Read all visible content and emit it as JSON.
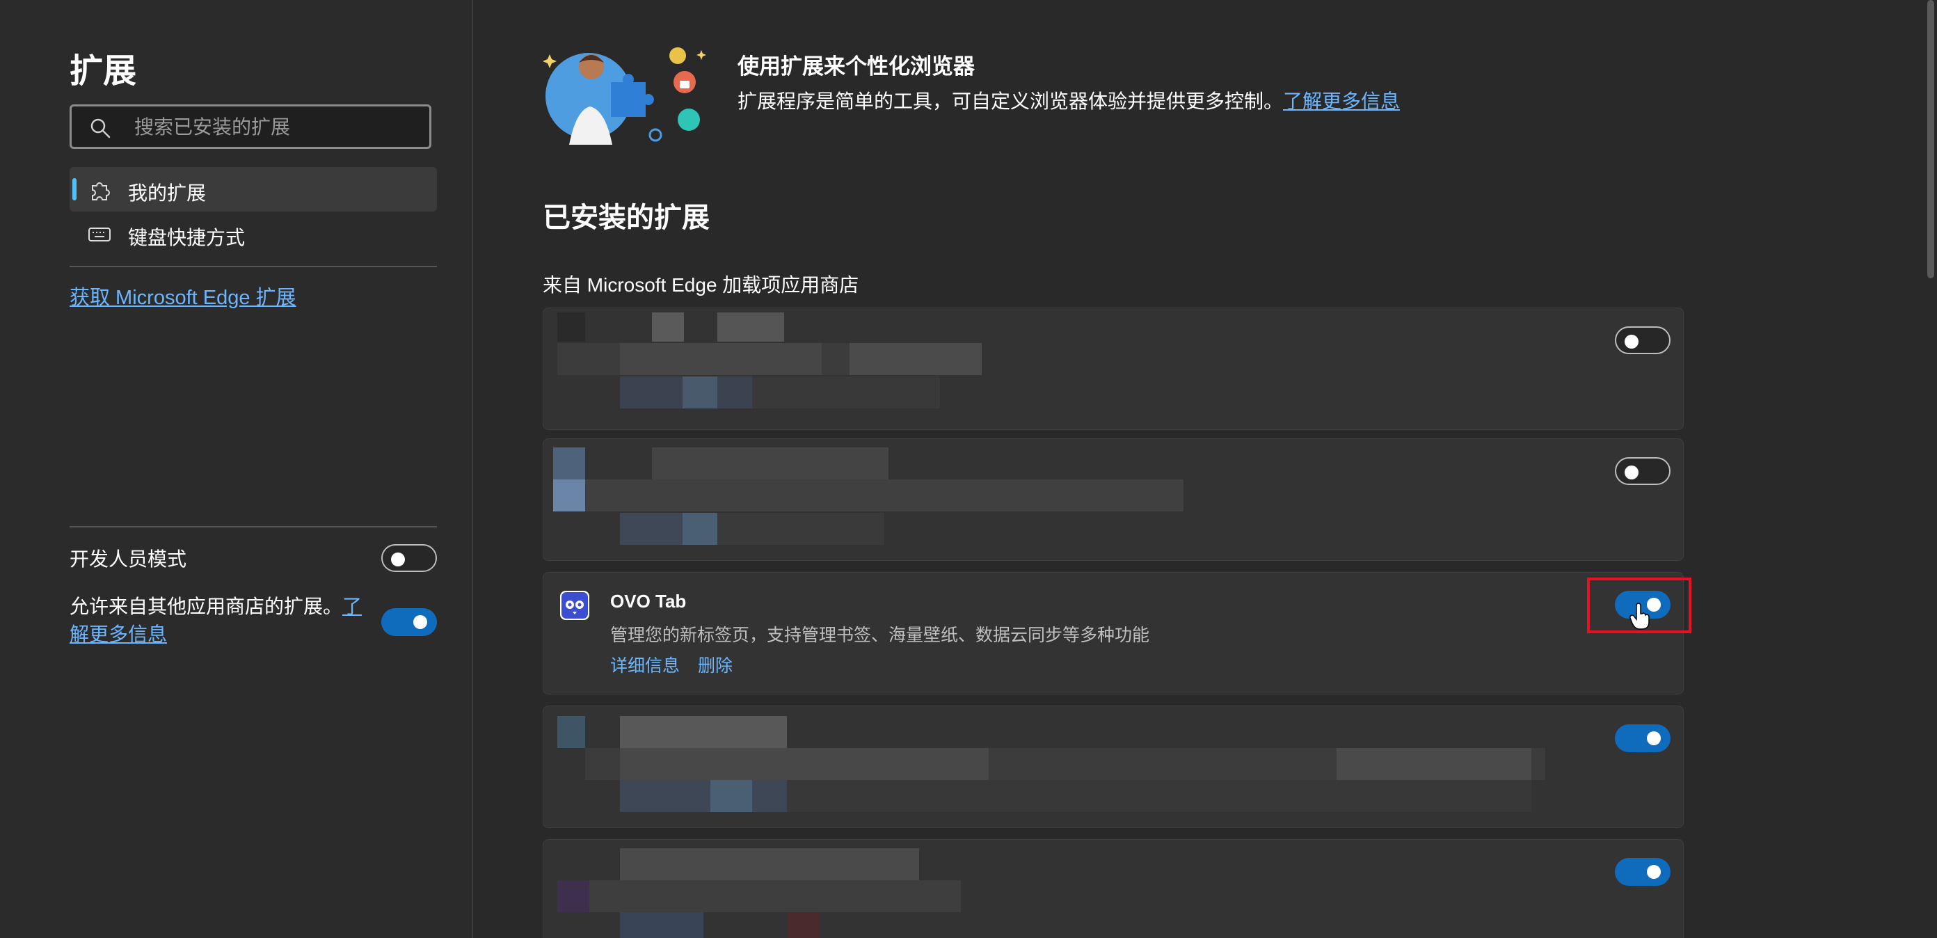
{
  "sidebar": {
    "title": "扩展",
    "search_placeholder": "搜索已安装的扩展",
    "nav": [
      {
        "label": "我的扩展",
        "icon": "puzzle-icon",
        "active": true
      },
      {
        "label": "键盘快捷方式",
        "icon": "keyboard-icon",
        "active": false
      }
    ],
    "get_extensions_link": "获取 Microsoft Edge 扩展",
    "developer_mode": {
      "label": "开发人员模式",
      "enabled": false
    },
    "allow_other_stores": {
      "label": "允许来自其他应用商店的扩展。",
      "link": "了解更多信息",
      "enabled": true
    }
  },
  "hero": {
    "title": "使用扩展来个性化浏览器",
    "description": "扩展程序是简单的工具，可自定义浏览器体验并提供更多控制。",
    "link": "了解更多信息"
  },
  "main": {
    "installed_title": "已安装的扩展",
    "store_section_title": "来自 Microsoft Edge 加载项应用商店",
    "extensions": [
      {
        "blurred": true,
        "enabled": false
      },
      {
        "blurred": true,
        "enabled": false
      },
      {
        "blurred": false,
        "name": "OVO Tab",
        "description": "管理您的新标签页，支持管理书签、海量壁纸、数据云同步等多种功能",
        "details_label": "详细信息",
        "remove_label": "删除",
        "enabled": true,
        "icon": "owl-icon"
      },
      {
        "blurred": true,
        "enabled": true
      },
      {
        "blurred": true,
        "enabled": true
      }
    ]
  },
  "colors": {
    "background": "#292929",
    "card": "#333333",
    "accent": "#0f6cbd",
    "link": "#6cb6ff",
    "highlight": "#e81123"
  }
}
